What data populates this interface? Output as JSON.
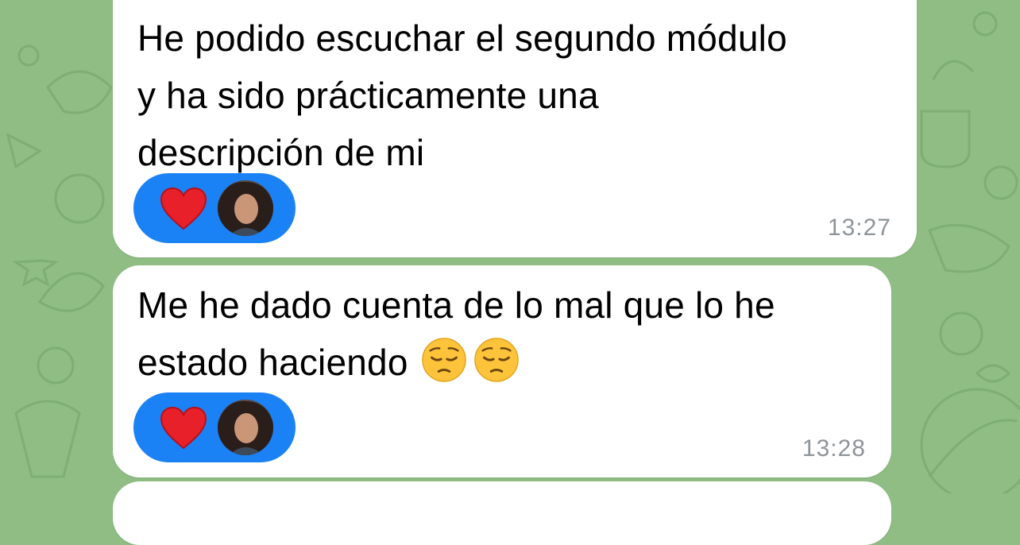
{
  "messages": [
    {
      "lines": [
        "He podido escuchar el segundo módulo",
        "y ha sido prácticamente una",
        "descripción de mi"
      ],
      "reaction": {
        "emoji": "heart",
        "count_avatar": "user-avatar"
      },
      "time": "13:27"
    },
    {
      "lines": [
        "Me he dado cuenta de lo mal que lo he",
        "estado haciendo"
      ],
      "trailing_emoji": [
        "pensive-face",
        "pensive-face"
      ],
      "reaction": {
        "emoji": "heart",
        "count_avatar": "user-avatar"
      },
      "time": "13:28"
    }
  ],
  "colors": {
    "chat_background": "#8fbd84",
    "bubble": "#ffffff",
    "reaction_pill": "#1b82f5",
    "heart": "#e8202a",
    "timestamp": "#8e9499"
  }
}
